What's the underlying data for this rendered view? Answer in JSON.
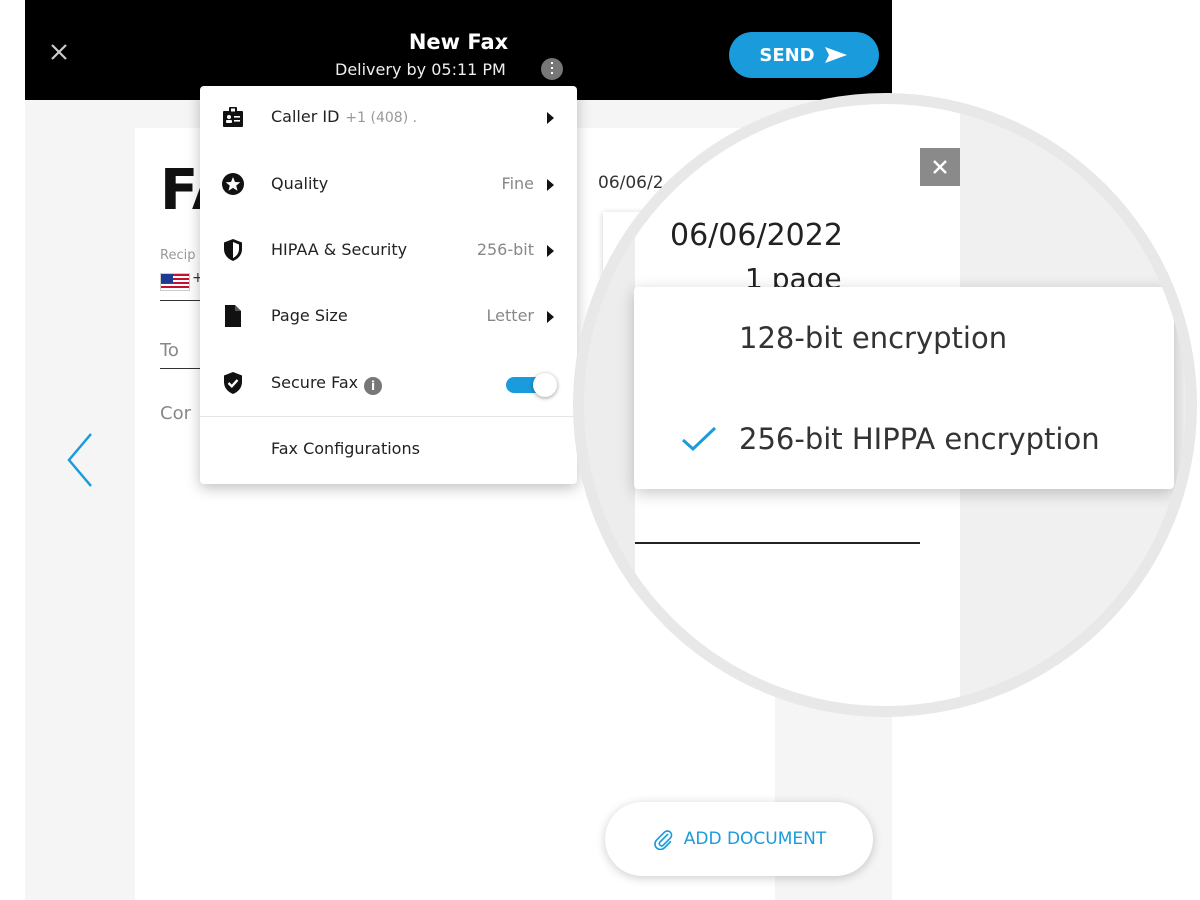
{
  "header": {
    "title": "New Fax",
    "subtitle": "Delivery by 05:11 PM",
    "send_label": "SEND"
  },
  "cover": {
    "heading": "FA",
    "recipient_label": "Recip",
    "phone_prefix": "+",
    "to_label": "To",
    "comment_label": "Cor",
    "date": "06/06/2"
  },
  "menu": {
    "items": [
      {
        "label": "Caller ID",
        "sub": "+1 (408) .",
        "value": "",
        "icon": "id-badge-icon"
      },
      {
        "label": "Quality",
        "sub": "",
        "value": "Fine",
        "icon": "star-icon"
      },
      {
        "label": "HIPAA & Security",
        "sub": "",
        "value": "256-bit",
        "icon": "shield-icon"
      },
      {
        "label": "Page Size",
        "sub": "",
        "value": "Letter",
        "icon": "file-icon"
      },
      {
        "label": "Secure Fax",
        "sub": "",
        "value": "",
        "icon": "shield-check-icon"
      }
    ],
    "secure_fax_info": "i",
    "secure_fax_enabled": true,
    "footer_label": "Fax Configurations"
  },
  "magnifier": {
    "date": "06/06/2022",
    "pages": "1 page",
    "options": [
      {
        "label": "128-bit encryption",
        "selected": false
      },
      {
        "label": "256-bit HIPPA encryption",
        "selected": true
      }
    ]
  },
  "add_document_label": "ADD DOCUMENT",
  "colors": {
    "accent": "#1a9bdc",
    "topbar": "#000000"
  }
}
